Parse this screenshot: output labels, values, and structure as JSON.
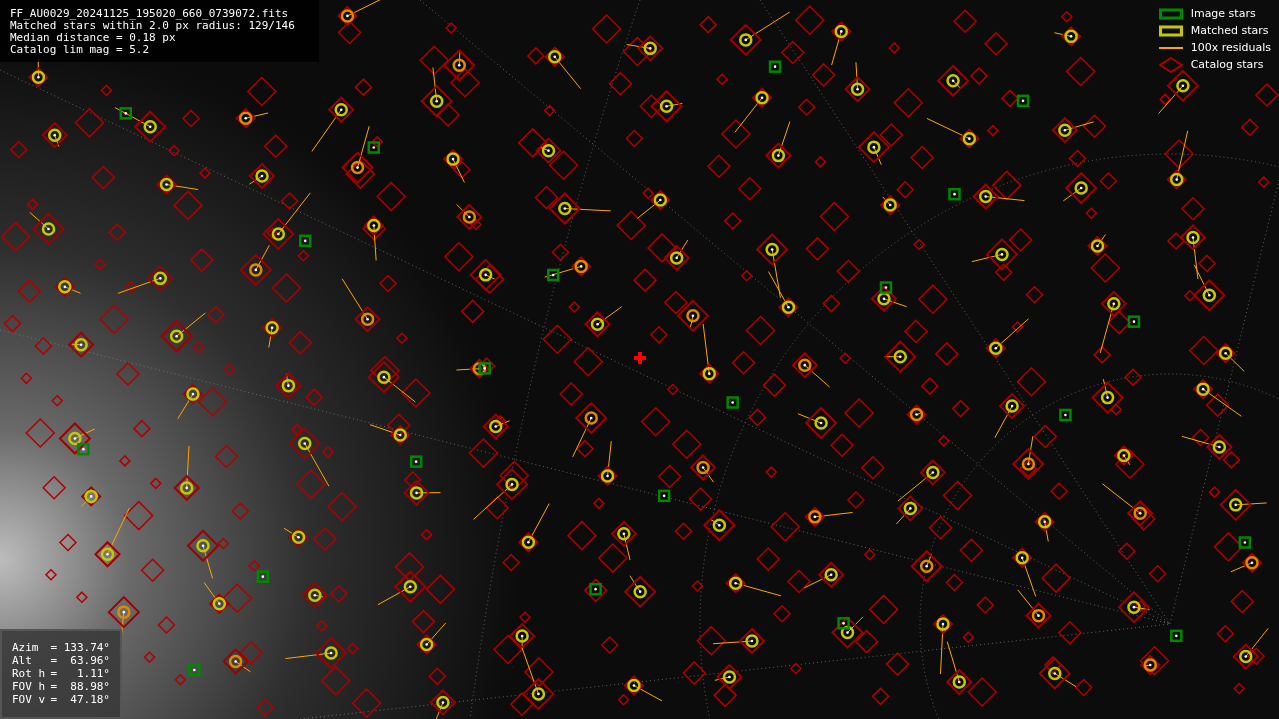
{
  "info_box": {
    "lines": [
      "FF_AU0029_20241125_195020_660_0739072.fits",
      "Matched stars within 2.0 px radius: 129/146",
      "Median distance = 0.18 px",
      "Catalog lim mag = 5.2"
    ]
  },
  "legend": [
    {
      "kind": "box",
      "color": "#008800",
      "label": "Image stars"
    },
    {
      "kind": "box",
      "color": "#c8c800",
      "label": "Matched stars"
    },
    {
      "kind": "line",
      "color": "#ffa500",
      "label": "100x residuals"
    },
    {
      "kind": "diamond",
      "color": "#b00000",
      "label": "Catalog stars"
    }
  ],
  "pointing_box": {
    "rows": [
      {
        "label": "Azim",
        "value": "= 133.74°"
      },
      {
        "label": "Alt",
        "value": "=  63.96°"
      },
      {
        "label": "Rot h",
        "value": "=   1.11°"
      },
      {
        "label": "FOV h",
        "value": "=  88.98°"
      },
      {
        "label": "FOV v",
        "value": "=  47.18°"
      }
    ]
  }
}
